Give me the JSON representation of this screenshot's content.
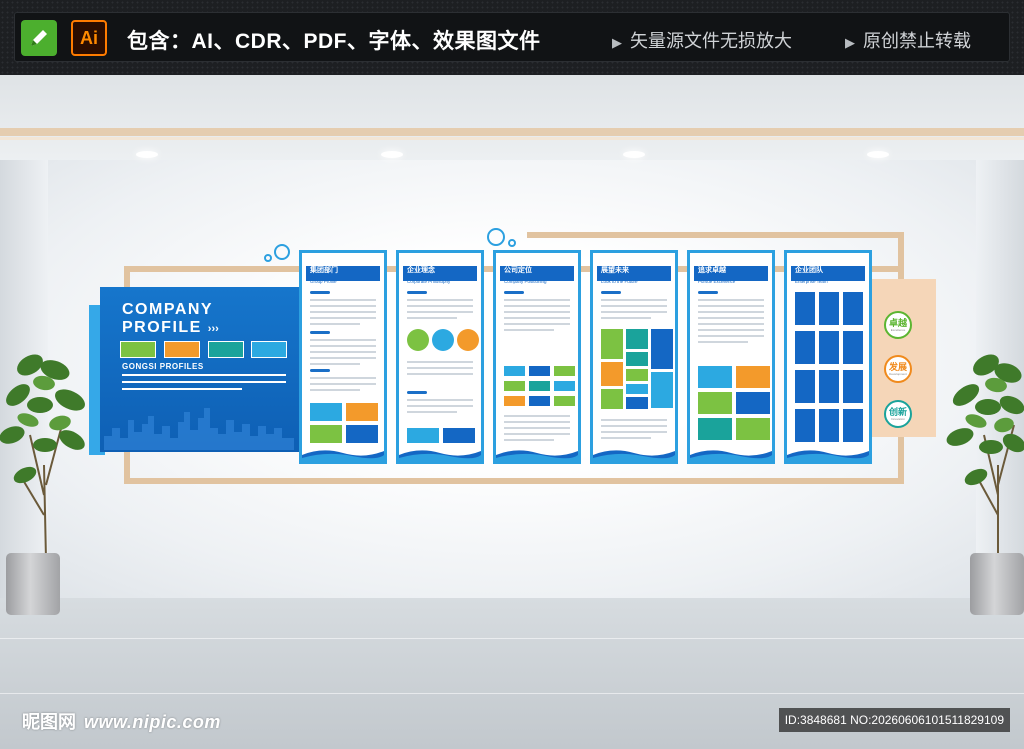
{
  "banner": {
    "cdr_icon": "pencil-icon",
    "ai_label": "Ai",
    "title": "包含：AI、CDR、PDF、字体、效果图文件",
    "note1": "矢量源文件无损放大",
    "note2": "原创禁止转载",
    "arrow": "▶"
  },
  "company": {
    "title_line1": "COMPANY",
    "title_line2": "PROFILE",
    "arrows": "›››",
    "subtitle": "GONGSI PROFILES",
    "swatches": [
      "#7cc242",
      "#f39a2b",
      "#1aa39b",
      "#2ca9e1"
    ]
  },
  "panels": [
    {
      "cn": "集团部门",
      "en": "Group Profile"
    },
    {
      "cn": "企业理念",
      "en": "Corporate Philosophy"
    },
    {
      "cn": "公司定位",
      "en": "Company Positioning"
    },
    {
      "cn": "展望未来",
      "en": "Look to the Future"
    },
    {
      "cn": "追求卓越",
      "en": "Pursue Excellence"
    },
    {
      "cn": "企业团队",
      "en": "Enterprise Team"
    }
  ],
  "badges": [
    {
      "cn": "卓越",
      "en": "Excellence",
      "color": "#5cb531"
    },
    {
      "cn": "发展",
      "en": "Development",
      "color": "#f08a1c"
    },
    {
      "cn": "创新",
      "en": "Innovation",
      "color": "#1aa39b"
    }
  ],
  "colors": {
    "blue": "#1467c4",
    "light_blue": "#2ca0e0",
    "green": "#7cc242",
    "orange": "#f39a2b",
    "teal": "#1aa39b",
    "wood": "#e1c3a0"
  },
  "watermark": {
    "logo": "昵图网",
    "url": "www.nipic.com",
    "id": "ID:3848681 NO:20260606101511829109"
  }
}
